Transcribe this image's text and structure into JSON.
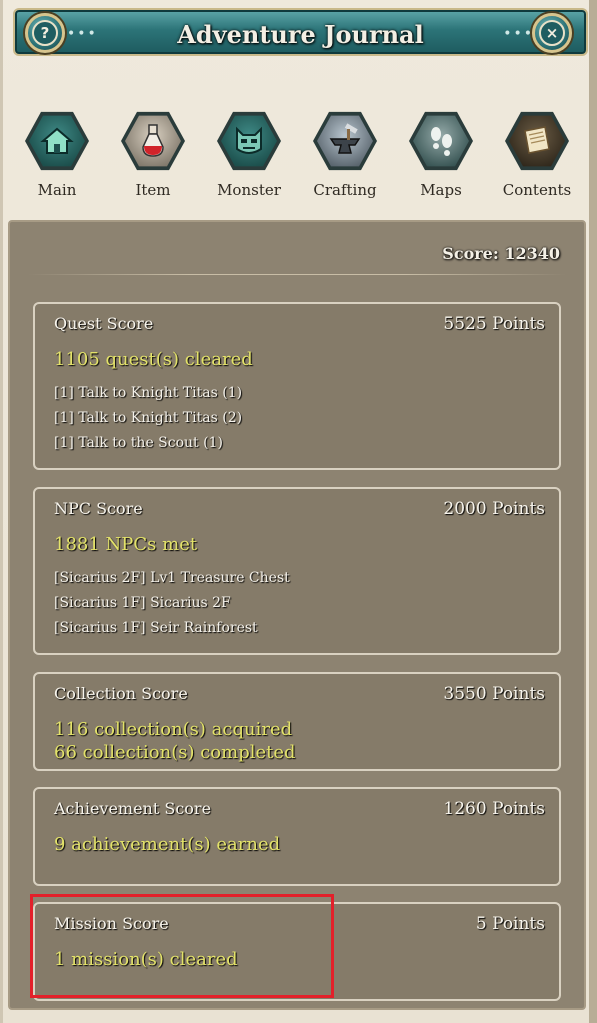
{
  "window": {
    "title": "Adventure Journal",
    "help_label": "?",
    "close_label": "×",
    "dots_left": "•••",
    "dots_right": "•••"
  },
  "nav": [
    {
      "label": "Main",
      "icon": "house-icon"
    },
    {
      "label": "Item",
      "icon": "potion-icon"
    },
    {
      "label": "Monster",
      "icon": "monster-icon"
    },
    {
      "label": "Crafting",
      "icon": "anvil-icon"
    },
    {
      "label": "Maps",
      "icon": "footprints-icon"
    },
    {
      "label": "Contents",
      "icon": "scroll-icon"
    }
  ],
  "score_total": "Score: 12340",
  "cards": {
    "quest": {
      "title": "Quest Score",
      "points": "5525 Points",
      "summary": [
        "1105 quest(s) cleared"
      ],
      "items": [
        "[1] Talk to Knight Titas (1)",
        "[1] Talk to Knight Titas (2)",
        "[1] Talk to the Scout (1)"
      ]
    },
    "npc": {
      "title": "NPC Score",
      "points": "2000 Points",
      "summary": [
        "1881 NPCs met"
      ],
      "items": [
        "[Sicarius 2F] Lv1 Treasure Chest",
        "[Sicarius 1F] Sicarius 2F",
        "[Sicarius 1F] Seir Rainforest"
      ]
    },
    "collection": {
      "title": "Collection Score",
      "points": "3550 Points",
      "summary": [
        "116 collection(s) acquired",
        "66 collection(s) completed"
      ]
    },
    "achievement": {
      "title": "Achievement Score",
      "points": "1260 Points",
      "summary": [
        "9 achievement(s) earned"
      ]
    },
    "mission": {
      "title": "Mission Score",
      "points": "5 Points",
      "summary": [
        "1 mission(s) cleared"
      ]
    }
  },
  "colors": {
    "title_bar": "#2c7478",
    "summary_text": "#e3e26a",
    "panel": "#8d8371",
    "highlight": "#e3202a"
  }
}
